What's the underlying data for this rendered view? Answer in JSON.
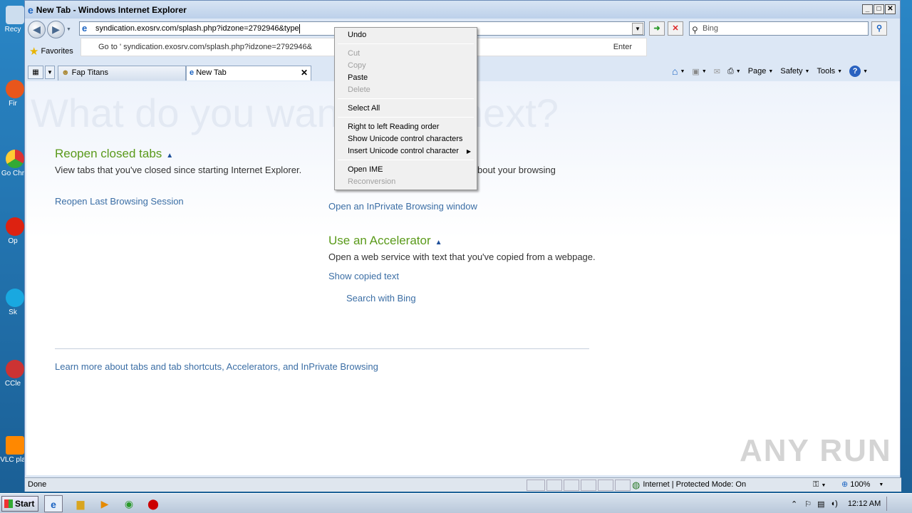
{
  "window": {
    "title": "New Tab - Windows Internet Explorer"
  },
  "address": {
    "url": "syndication.exosrv.com/splash.php?idzone=2792946&type"
  },
  "search": {
    "placeholder": "Bing"
  },
  "suggestion": {
    "text": "Go to ' syndication.exosrv.com/splash.php?idzone=2792946&",
    "enter": "Enter"
  },
  "favorites": {
    "label": "Favorites"
  },
  "tabs": [
    {
      "label": "Fap Titans"
    },
    {
      "label": "New Tab",
      "close": "✕"
    }
  ],
  "commandbar": {
    "page": "Page",
    "safety": "Safety",
    "tools": "Tools"
  },
  "content": {
    "question": "What do you want to do next?",
    "reopen": {
      "heading": "Reopen closed tabs",
      "desc": "View tabs that you've closed since starting Internet Explorer.",
      "link": "Reopen Last Browsing Session"
    },
    "inprivate": {
      "desc_tail": "g data about your browsing",
      "link": "Open an InPrivate Browsing window"
    },
    "accelerator": {
      "heading": "Use an Accelerator",
      "desc": "Open a web service with text that you've copied from a webpage.",
      "show": "Show copied text",
      "search": "Search with Bing"
    },
    "learn_more": "Learn more about tabs and tab shortcuts, Accelerators, and InPrivate Browsing"
  },
  "context_menu": {
    "undo": "Undo",
    "cut": "Cut",
    "copy": "Copy",
    "paste": "Paste",
    "delete": "Delete",
    "select_all": "Select All",
    "rtl": "Right to left Reading order",
    "show_unicode": "Show Unicode control characters",
    "insert_unicode": "Insert Unicode control character",
    "open_ime": "Open IME",
    "reconversion": "Reconversion"
  },
  "status": {
    "left": "Done",
    "zone": "Internet | Protected Mode: On",
    "zoom": "100%"
  },
  "taskbar": {
    "start": "Start",
    "clock": "12:12 AM"
  },
  "desktop_icons": [
    "Recy",
    "Fir",
    "Go Chr",
    "Op",
    "Sk",
    "CCle",
    "VLC pla"
  ],
  "watermark": "ANY RUN"
}
